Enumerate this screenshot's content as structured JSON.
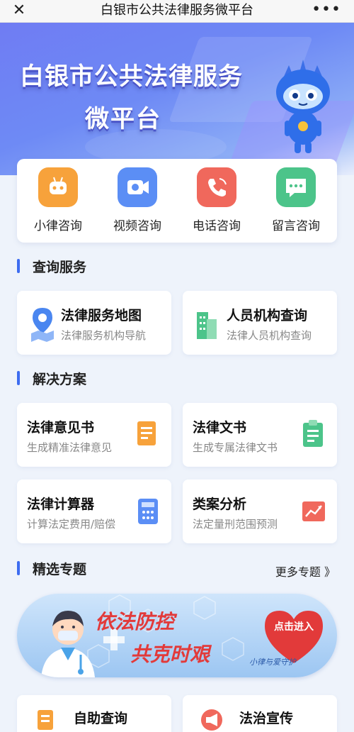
{
  "topbar": {
    "title": "白银市公共法律服务微平台",
    "close_glyph": "✕",
    "more_glyph": "•••"
  },
  "hero": {
    "line1": "白银市公共法律服务",
    "line2": "微平台"
  },
  "quick": [
    {
      "label": "小律咨询",
      "color": "#f7a23b",
      "icon": "robot-icon"
    },
    {
      "label": "视频咨询",
      "color": "#5b8ef5",
      "icon": "video-camera-icon"
    },
    {
      "label": "电话咨询",
      "color": "#f0685c",
      "icon": "phone-icon"
    },
    {
      "label": "留言咨询",
      "color": "#4cc48a",
      "icon": "message-icon"
    }
  ],
  "sections": {
    "query": "查询服务",
    "solutions": "解决方案",
    "topics": "精选专题",
    "more_topics": "更多专题 》"
  },
  "query_cards": [
    {
      "title": "法律服务地图",
      "subtitle": "法律服务机构导航",
      "icon": "map-pin-icon"
    },
    {
      "title": "人员机构查询",
      "subtitle": "法律人员机构查询",
      "icon": "building-icon"
    }
  ],
  "solution_cards": [
    {
      "title": "法律意见书",
      "subtitle": "生成精准法律意见",
      "icon": "document-icon"
    },
    {
      "title": "法律文书",
      "subtitle": "生成专属法律文书",
      "icon": "clipboard-icon"
    },
    {
      "title": "法律计算器",
      "subtitle": "计算法定费用/赔偿",
      "icon": "calculator-icon"
    },
    {
      "title": "类案分析",
      "subtitle": "法定量刑范围预测",
      "icon": "chart-icon"
    }
  ],
  "banner": {
    "line1": "依法防控",
    "line2": "共克时艰",
    "heart_text": "点击进入",
    "signature": "小律与爱守护"
  },
  "bottom_cards": [
    {
      "title": "自助查询"
    },
    {
      "title": "法治宣传"
    }
  ],
  "colors": {
    "accent": "#3d6cf0",
    "banner_red": "#e23a3a"
  }
}
